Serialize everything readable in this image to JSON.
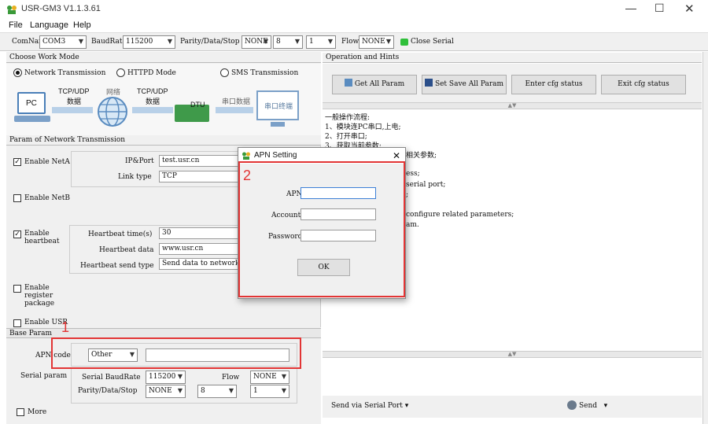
{
  "window": {
    "title": "USR-GM3 V1.1.3.61"
  },
  "menu": [
    "File",
    "Language",
    "Help"
  ],
  "toolbar": {
    "comname_label": "ComName",
    "comname": "COM3",
    "baudrate_label": "BaudRate",
    "baudrate": "115200",
    "parity_label": "Parity/Data/Stop",
    "parity": "NONE",
    "data": "8",
    "stop": "1",
    "flow_label": "Flow",
    "flow": "NONE",
    "close_serial": "Close Serial"
  },
  "work_mode": {
    "title": "Choose Work Mode",
    "options": [
      "Network Transmission",
      "HTTPD Mode",
      "SMS Transmission"
    ],
    "diagram": {
      "pc": "PC",
      "tcp1": "TCP/UDP",
      "data1": "数据",
      "network": "网络",
      "tcp2": "TCP/UDP",
      "data2": "数据",
      "dtu": "DTU",
      "serial_data": "串口数据",
      "serial_terminal": "串口终端"
    }
  },
  "net_param": {
    "title": "Param of Network Transmission",
    "enable_neta": "Enable NetA",
    "ip_port_label": "IP&Port",
    "ip_port": "test.usr.cn",
    "link_type_label": "Link type",
    "link_type": "TCP",
    "enable_netb": "Enable NetB",
    "enable_heartbeat": "Enable heartbeat",
    "hb_time_label": "Heartbeat time(s)",
    "hb_time": "30",
    "hb_data_label": "Heartbeat data",
    "hb_data": "www.usr.cn",
    "hb_send_label": "Heartbeat send type",
    "hb_send": "Send data to network",
    "enable_register": "Enable register package",
    "enable_usr": "Enable USR"
  },
  "base_param": {
    "title": "Base Param",
    "apn_code_label": "APN code",
    "apn_code": "Other",
    "apn_value": "",
    "serial_param_label": "Serial param",
    "serial_baud_label": "Serial BaudRate",
    "serial_baud": "115200",
    "flow_label": "Flow",
    "flow": "NONE",
    "parity_label": "Parity/Data/Stop",
    "parity": "NONE",
    "data": "8",
    "stop": "1",
    "more": "More"
  },
  "operation": {
    "title": "Operation and Hints",
    "buttons": {
      "get_all": "Get All Param",
      "set_save": "Set Save All Param",
      "enter_cfg": "Enter cfg status",
      "exit_cfg": "Exit cfg status"
    },
    "hints": [
      "一般操作流程:",
      "1、模块连PC串口,上电;",
      "2、打开串口;",
      "3、获取当前参数;",
      "相关参数;",
      "ess;",
      "serial port;",
      ";",
      "configure related parameters;",
      "am."
    ],
    "send_via": "Send via Serial Port",
    "send": "Send"
  },
  "dialog": {
    "title": "APN Setting",
    "apn_label": "APN",
    "account_label": "Account",
    "password_label": "Password",
    "apn": "",
    "account": "",
    "password": "",
    "ok": "OK"
  },
  "annotations": {
    "one": "1",
    "two": "2"
  }
}
